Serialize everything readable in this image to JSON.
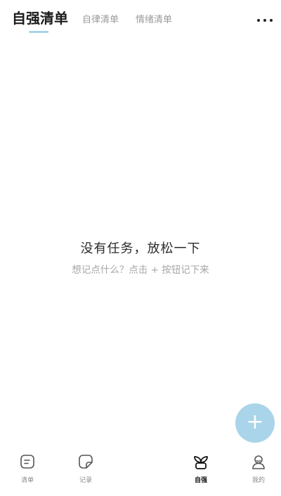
{
  "header": {
    "tabs": [
      {
        "label": "自强清单",
        "active": true
      },
      {
        "label": "自律清单",
        "active": false
      },
      {
        "label": "情绪清单",
        "active": false
      }
    ],
    "more_icon": "more-horizontal-icon"
  },
  "empty_state": {
    "title": "没有任务，放松一下",
    "hint": "想记点什么？点击 + 按钮记下来"
  },
  "fab": {
    "label": "+",
    "color": "#a9d4e9"
  },
  "bottom_nav": {
    "items": [
      {
        "label": "清单",
        "icon": "list-icon",
        "active": false
      },
      {
        "label": "记录",
        "icon": "note-icon",
        "active": false
      },
      {
        "label": "自强",
        "icon": "sprout-icon",
        "active": true
      },
      {
        "label": "我的",
        "icon": "profile-icon",
        "active": false
      }
    ],
    "center_icon": "face-icon"
  },
  "colors": {
    "accent": "#a9d4e9",
    "center_button": "#151515"
  }
}
